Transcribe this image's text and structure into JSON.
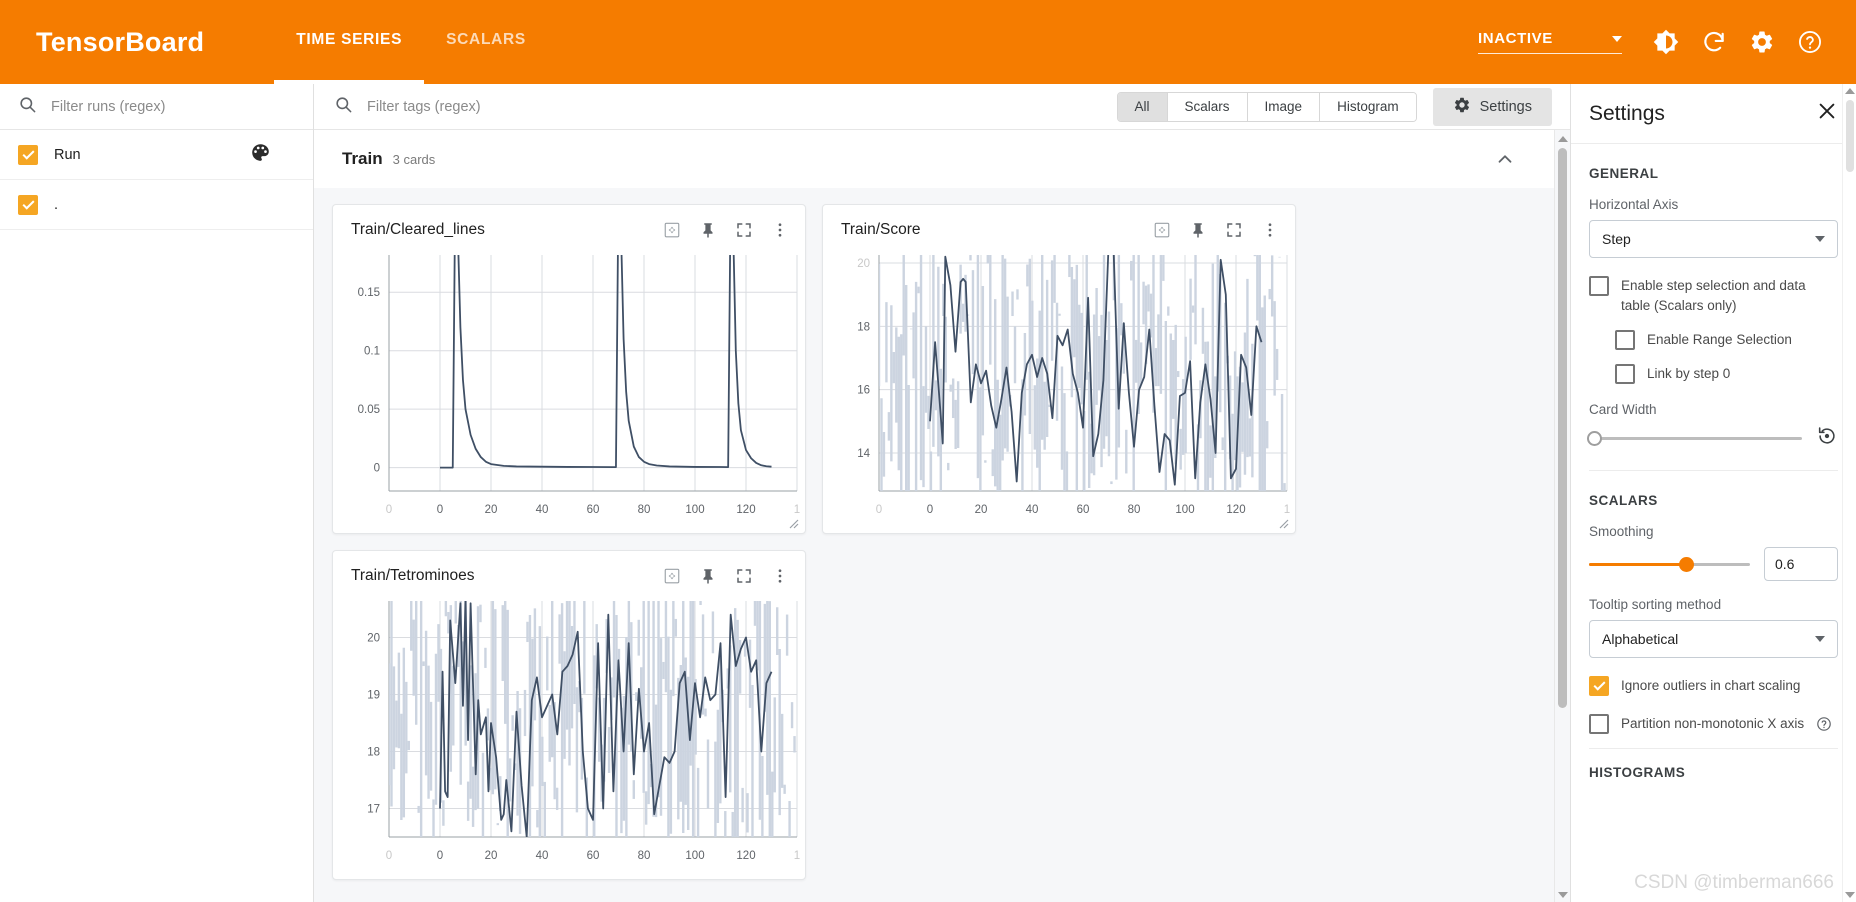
{
  "header": {
    "brand": "TensorBoard",
    "tabs": [
      {
        "label": "TIME SERIES",
        "active": true
      },
      {
        "label": "SCALARS",
        "active": false
      }
    ],
    "status": "INACTIVE",
    "icons": [
      "brightness-icon",
      "refresh-icon",
      "gear-icon",
      "help-icon"
    ],
    "accent_color": "#f57c00"
  },
  "runs_pane": {
    "search_placeholder": "Filter runs (regex)",
    "rows": [
      {
        "label": "Run",
        "checked": true,
        "right_icon": "palette-icon"
      },
      {
        "label": ".",
        "checked": true,
        "right_icon": "color-swatch",
        "swatch_color": "#3f4f65"
      }
    ]
  },
  "tag_bar": {
    "search_placeholder": "Filter tags (regex)",
    "filters": [
      {
        "label": "All",
        "active": true
      },
      {
        "label": "Scalars",
        "active": false
      },
      {
        "label": "Image",
        "active": false
      },
      {
        "label": "Histogram",
        "active": false
      }
    ],
    "settings_button": "Settings"
  },
  "group": {
    "title": "Train",
    "count": "3 cards",
    "collapse_icon": "chevron-up-icon"
  },
  "cards": [
    {
      "title": "Train/Cleared_lines"
    },
    {
      "title": "Train/Score"
    },
    {
      "title": "Train/Tetrominoes"
    }
  ],
  "card_actions": [
    "fit-to-domain-icon",
    "pin-icon",
    "fullscreen-icon",
    "more-options-icon"
  ],
  "settings": {
    "title": "Settings",
    "close_icon": "close-icon",
    "general_section": "GENERAL",
    "horizontal_axis_label": "Horizontal Axis",
    "horizontal_axis_value": "Step",
    "step_selection_label": "Enable step selection and data table (Scalars only)",
    "step_selection_checked": false,
    "range_selection_label": "Enable Range Selection",
    "range_selection_checked": false,
    "link_by_step_label": "Link by step 0",
    "link_by_step_checked": false,
    "card_width_label": "Card Width",
    "card_width_percent": 0,
    "card_width_reset_icon": "reset-icon",
    "scalars_section": "SCALARS",
    "smoothing_label": "Smoothing",
    "smoothing_value": "0.6",
    "smoothing_percent": 60,
    "tooltip_sort_label": "Tooltip sorting method",
    "tooltip_sort_value": "Alphabetical",
    "ignore_outliers_label": "Ignore outliers in chart scaling",
    "ignore_outliers_checked": true,
    "partition_label": "Partition non-monotonic X axis",
    "partition_checked": false,
    "partition_help_icon": "help-icon",
    "histograms_section": "HISTOGRAMS"
  },
  "watermark": "CSDN @timberman666",
  "chart_data": [
    {
      "type": "line",
      "title": "Train/Cleared_lines",
      "xlabel": "",
      "ylabel": "",
      "xlim": [
        -20,
        140
      ],
      "ylim": [
        -0.02,
        0.175
      ],
      "xticks": [
        -20,
        0,
        20,
        40,
        60,
        80,
        100,
        120,
        140
      ],
      "xticklabels": [
        "0",
        "0",
        "20",
        "40",
        "60",
        "80",
        "100",
        "120",
        "1"
      ],
      "yticks": [
        0,
        0.05,
        0.1,
        0.15
      ],
      "yticklabels": [
        "0",
        "0.05",
        "0.1",
        "0.15"
      ],
      "grid": true,
      "legend": "none",
      "series": [
        {
          "name": "smoothed",
          "color": "#3f4f65",
          "x": [
            0,
            5,
            6,
            6.5,
            7,
            8,
            9,
            10,
            12,
            14,
            16,
            18,
            20,
            25,
            30,
            40,
            50,
            60,
            68,
            69,
            70,
            70.5,
            71,
            72,
            73,
            74,
            76,
            78,
            80,
            82,
            85,
            90,
            100,
            110,
            113,
            114,
            114.5,
            115,
            116,
            117,
            118,
            120,
            122,
            124,
            126,
            128,
            130
          ],
          "y": [
            0.0,
            0.0,
            0.24,
            0.24,
            0.2,
            0.12,
            0.075,
            0.05,
            0.028,
            0.016,
            0.009,
            0.005,
            0.003,
            0.0015,
            0.001,
            0.0008,
            0.0006,
            0.0005,
            0.0004,
            0.0004,
            0.24,
            0.24,
            0.2,
            0.11,
            0.065,
            0.04,
            0.018,
            0.009,
            0.005,
            0.003,
            0.0018,
            0.001,
            0.0006,
            0.0005,
            0.0004,
            0.24,
            0.24,
            0.2,
            0.1,
            0.055,
            0.032,
            0.015,
            0.008,
            0.004,
            0.002,
            0.0012,
            0.0008
          ]
        }
      ]
    },
    {
      "type": "line",
      "title": "Train/Score",
      "xlabel": "",
      "ylabel": "",
      "xlim": [
        -20,
        140
      ],
      "ylim": [
        12.8,
        20
      ],
      "xticks": [
        -20,
        0,
        20,
        40,
        60,
        80,
        100,
        120,
        140
      ],
      "xticklabels": [
        "0",
        "0",
        "20",
        "40",
        "60",
        "80",
        "100",
        "120",
        "1"
      ],
      "yticks": [
        14,
        16,
        18,
        20
      ],
      "yticklabels": [
        "14",
        "16",
        "18",
        "20"
      ],
      "grid": true,
      "legend": "none",
      "series": [
        {
          "name": "raw",
          "color": "#ccd4e0",
          "note": "high-variance raw scalar values, range roughly 12 to 21"
        },
        {
          "name": "smoothed",
          "color": "#3f4f65",
          "x": [
            0,
            2,
            4,
            5,
            6,
            8,
            10,
            12,
            13,
            14,
            16,
            18,
            20,
            22,
            24,
            26,
            28,
            30,
            32,
            34,
            36,
            38,
            40,
            42,
            44,
            46,
            48,
            50,
            52,
            54,
            56,
            58,
            60,
            62,
            64,
            66,
            68,
            70,
            72,
            74,
            76,
            78,
            80,
            82,
            84,
            86,
            88,
            90,
            92,
            94,
            96,
            98,
            100,
            102,
            104,
            106,
            108,
            110,
            112,
            114,
            116,
            118,
            120,
            122,
            124,
            126,
            128,
            130
          ],
          "y": [
            15.0,
            17.5,
            15.4,
            14.3,
            20.2,
            19.3,
            17.2,
            19.4,
            19.5,
            19.4,
            15.6,
            16.8,
            16.2,
            16.6,
            15.5,
            14.8,
            15.7,
            16.7,
            15.3,
            13.1,
            15.9,
            16.8,
            17.1,
            16.4,
            17.0,
            16.5,
            15.1,
            17.7,
            17.4,
            17.9,
            16.5,
            15.9,
            14.8,
            18.9,
            13.9,
            14.6,
            16.3,
            20.5,
            20.4,
            15.4,
            18.1,
            15.9,
            14.2,
            16.0,
            16.4,
            17.9,
            15.5,
            13.4,
            14.6,
            14.4,
            13.0,
            15.8,
            15.9,
            16.9,
            13.2,
            15.6,
            16.8,
            15.7,
            14.0,
            20.1,
            19.0,
            13.2,
            13.5,
            17.1,
            16.7,
            15.2,
            18.0,
            17.5
          ]
        }
      ]
    },
    {
      "type": "line",
      "title": "Train/Tetrominoes",
      "xlabel": "",
      "ylabel": "",
      "xlim": [
        -20,
        140
      ],
      "ylim": [
        16.5,
        20.5
      ],
      "xticks": [
        -20,
        0,
        20,
        40,
        60,
        80,
        100,
        120,
        140
      ],
      "xticklabels": [
        "0",
        "0",
        "20",
        "40",
        "60",
        "80",
        "100",
        "120",
        "1"
      ],
      "yticks": [
        17,
        18,
        19,
        20
      ],
      "yticklabels": [
        "17",
        "18",
        "19",
        "20"
      ],
      "grid": true,
      "legend": "none",
      "series": [
        {
          "name": "raw",
          "color": "#ccd4e0",
          "note": "high-variance raw scalar values, range roughly 16 to 21"
        },
        {
          "name": "smoothed",
          "color": "#3f4f65",
          "x": [
            0,
            1,
            2,
            3,
            4,
            6,
            8,
            9,
            10,
            11,
            12,
            14,
            15,
            16,
            18,
            19,
            20,
            22,
            24,
            25,
            26,
            28,
            30,
            32,
            34,
            36,
            38,
            40,
            42,
            44,
            46,
            48,
            50,
            52,
            54,
            56,
            58,
            60,
            62,
            64,
            66,
            68,
            70,
            72,
            74,
            76,
            78,
            80,
            82,
            84,
            86,
            88,
            90,
            92,
            94,
            96,
            98,
            100,
            102,
            104,
            106,
            108,
            110,
            112,
            114,
            116,
            118,
            120,
            122,
            124,
            126,
            128,
            130
          ],
          "y": [
            17.0,
            19.4,
            17.3,
            17.2,
            20.3,
            19.2,
            20.6,
            18.8,
            20.7,
            18.2,
            20.6,
            17.6,
            18.9,
            18.3,
            18.6,
            17.3,
            18.5,
            17.9,
            16.8,
            16.9,
            17.5,
            16.6,
            18.7,
            17.4,
            16.5,
            18.9,
            19.3,
            18.6,
            18.8,
            19.0,
            18.3,
            19.4,
            19.5,
            19.7,
            20.1,
            18.0,
            17.0,
            16.8,
            19.9,
            17.0,
            20.4,
            17.3,
            19.6,
            18.0,
            19.9,
            17.6,
            19.1,
            18.0,
            18.5,
            16.9,
            17.4,
            17.9,
            17.8,
            18.0,
            19.2,
            19.4,
            18.2,
            19.2,
            18.6,
            19.3,
            18.9,
            19.0,
            19.9,
            17.2,
            20.4,
            19.5,
            19.8,
            20.0,
            19.4,
            19.6,
            18.0,
            19.2,
            19.4
          ]
        }
      ]
    }
  ]
}
